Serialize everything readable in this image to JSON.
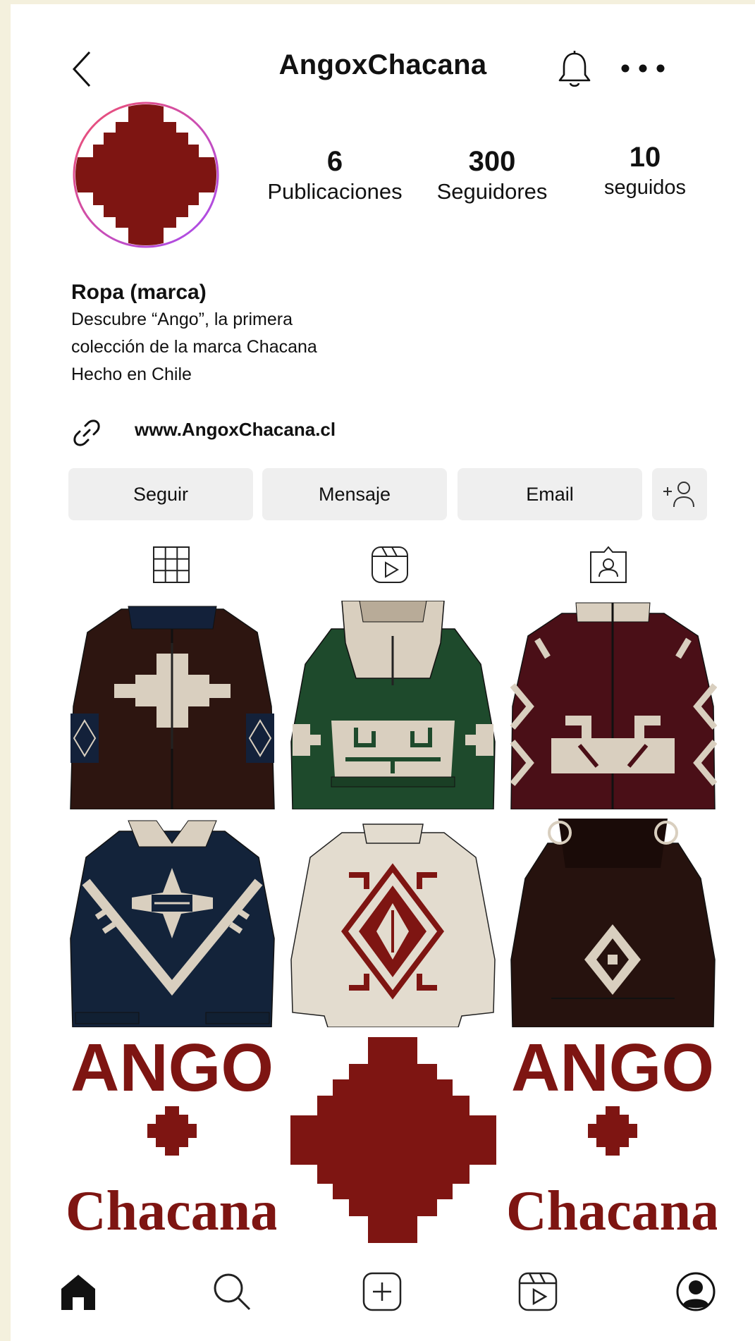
{
  "header": {
    "title": "AngoxChacana",
    "back_icon": "chevron-left-icon",
    "bell_icon": "bell-icon",
    "more_icon": "more-horizontal-icon"
  },
  "profile": {
    "avatar_icon": "chacana-cross-logo",
    "stats": [
      {
        "value": "6",
        "label": "Publicaciones"
      },
      {
        "value": "300",
        "label": "Seguidores"
      },
      {
        "value": "10",
        "label": "seguidos"
      }
    ],
    "bio": {
      "name": "Ropa (marca)",
      "lines": [
        "Descubre “Ango”, la primera",
        "colección de la marca Chacana",
        "Hecho en Chile"
      ]
    },
    "link": "www.AngoxChacana.cl"
  },
  "actions": {
    "follow": "Seguir",
    "message": "Mensaje",
    "email": "Email",
    "add_user_icon": "add-user-icon"
  },
  "tabs": [
    "grid-icon",
    "reels-icon",
    "tagged-icon"
  ],
  "posts": [
    {
      "type": "jacket-brown"
    },
    {
      "type": "hoodie-green"
    },
    {
      "type": "jacket-burgundy"
    },
    {
      "type": "jacket-navy"
    },
    {
      "type": "sweater-cream"
    },
    {
      "type": "hoodie-dark-brown"
    },
    {
      "type": "logo-text",
      "text_top": "ANGO",
      "text_bottom": "Chacana"
    },
    {
      "type": "cross-logo"
    },
    {
      "type": "logo-text",
      "text_top": "ANGO",
      "text_bottom": "Chacana"
    }
  ],
  "bottom_nav": [
    "home-icon",
    "search-icon",
    "create-icon",
    "reels-icon",
    "profile-icon"
  ],
  "colors": {
    "brand_red": "#7e1512",
    "outer_bg": "#f4f0dd",
    "button_bg": "#efefef"
  }
}
